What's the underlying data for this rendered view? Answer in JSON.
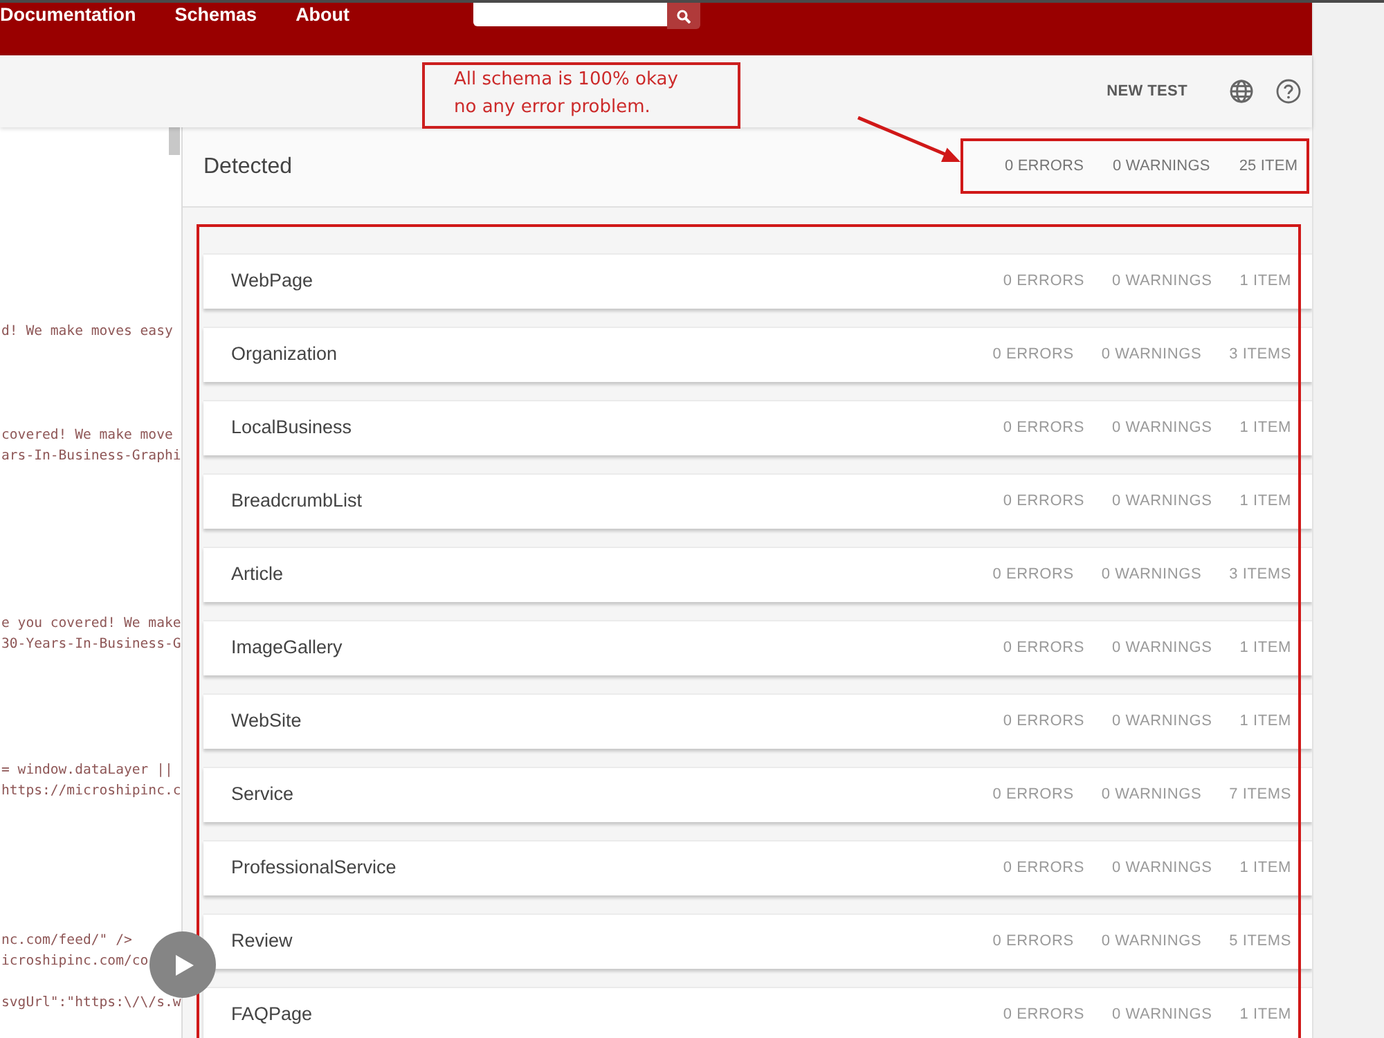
{
  "nav": {
    "links": [
      "Documentation",
      "Schemas",
      "About"
    ]
  },
  "toolbar": {
    "new_test": "NEW TEST"
  },
  "note": "All schema is 100% okay\nno any error problem.",
  "code_panel": {
    "line_groups": [
      [
        "d! We make moves easy"
      ],
      [
        "covered! We make move",
        "ars-In-Business-Graphi"
      ],
      [
        "e you covered! We make",
        "30-Years-In-Business-G"
      ],
      [
        "= window.dataLayer ||",
        "https://microshipinc.c"
      ],
      [
        "nc.com/feed/\" />",
        "icroshipinc.com/co"
      ],
      [
        "svgUrl\":\"https:\\/\\/s.w"
      ]
    ]
  },
  "summary": {
    "title": "Detected",
    "errors": "0 ERRORS",
    "warnings": "0 WARNINGS",
    "items": "25 ITEM"
  },
  "schemas": [
    {
      "name": "WebPage",
      "errors": "0 ERRORS",
      "warnings": "0 WARNINGS",
      "items": "1 ITEM"
    },
    {
      "name": "Organization",
      "errors": "0 ERRORS",
      "warnings": "0 WARNINGS",
      "items": "3 ITEMS"
    },
    {
      "name": "LocalBusiness",
      "errors": "0 ERRORS",
      "warnings": "0 WARNINGS",
      "items": "1 ITEM"
    },
    {
      "name": "BreadcrumbList",
      "errors": "0 ERRORS",
      "warnings": "0 WARNINGS",
      "items": "1 ITEM"
    },
    {
      "name": "Article",
      "errors": "0 ERRORS",
      "warnings": "0 WARNINGS",
      "items": "3 ITEMS"
    },
    {
      "name": "ImageGallery",
      "errors": "0 ERRORS",
      "warnings": "0 WARNINGS",
      "items": "1 ITEM"
    },
    {
      "name": "WebSite",
      "errors": "0 ERRORS",
      "warnings": "0 WARNINGS",
      "items": "1 ITEM"
    },
    {
      "name": "Service",
      "errors": "0 ERRORS",
      "warnings": "0 WARNINGS",
      "items": "7 ITEMS"
    },
    {
      "name": "ProfessionalService",
      "errors": "0 ERRORS",
      "warnings": "0 WARNINGS",
      "items": "1 ITEM"
    },
    {
      "name": "Review",
      "errors": "0 ERRORS",
      "warnings": "0 WARNINGS",
      "items": "5 ITEMS"
    },
    {
      "name": "FAQPage",
      "errors": "0 ERRORS",
      "warnings": "0 WARNINGS",
      "items": "1 ITEM"
    }
  ]
}
